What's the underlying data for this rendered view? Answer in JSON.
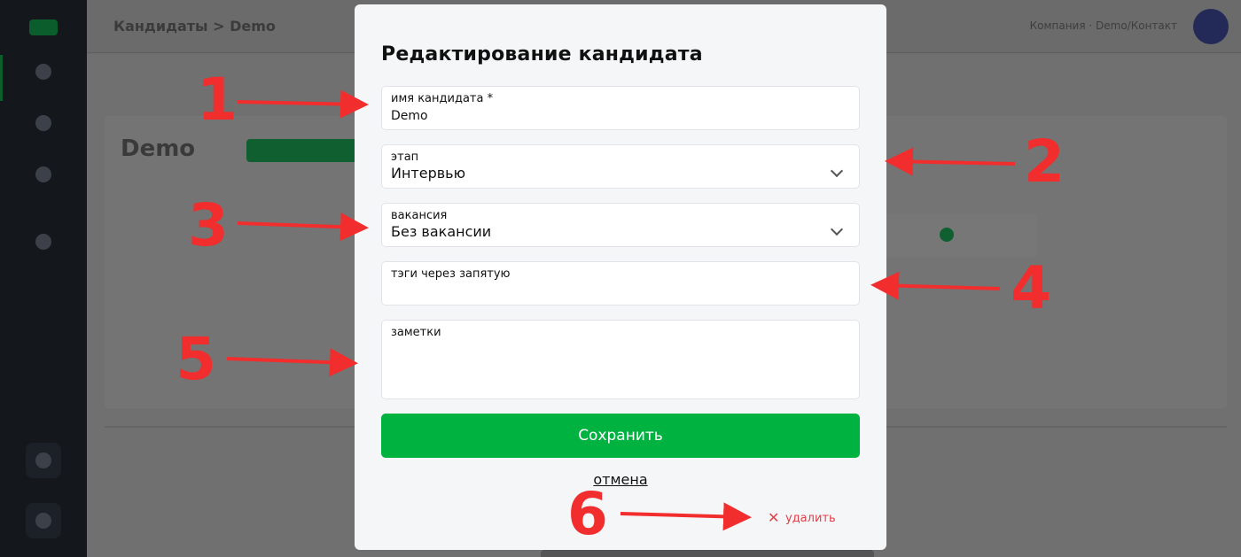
{
  "modal": {
    "title": "Редактирование кандидата",
    "fields": {
      "name": {
        "label": "имя кандидата *",
        "value": "Demo"
      },
      "stage": {
        "label": "этап",
        "value": "Интервью"
      },
      "vacancy": {
        "label": "вакансия",
        "value": "Без вакансии"
      },
      "tags": {
        "label": "тэги через запятую",
        "value": ""
      },
      "notes": {
        "label": "заметки",
        "value": ""
      }
    },
    "save_label": "Сохранить",
    "cancel_label": "отмена",
    "delete_label": "удалить"
  },
  "background": {
    "header_title": "Кандидаты > Demo",
    "header_right": "Компания · Demo/Контакт",
    "candidate_name": "Demo"
  },
  "annotations": {
    "markers": [
      "1",
      "2",
      "3",
      "4",
      "5",
      "6"
    ],
    "color": "#f12d2d"
  },
  "colors": {
    "accent": "#00b341",
    "danger": "#e0404a"
  }
}
